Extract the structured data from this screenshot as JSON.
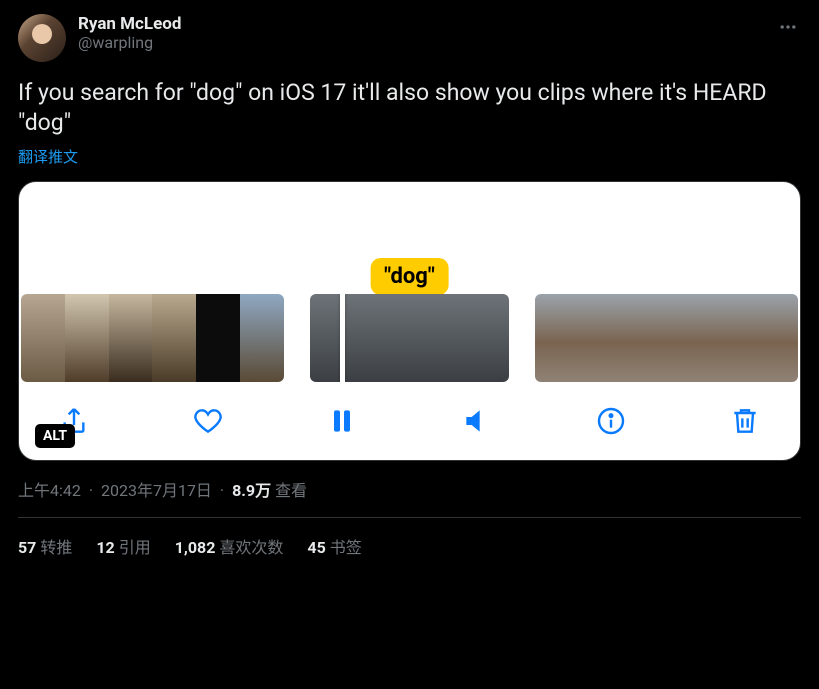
{
  "author": {
    "display_name": "Ryan McLeod",
    "handle": "@warpling"
  },
  "tweet_text": "If you search for \"dog\" on iOS 17 it'll also show you clips where it's HEARD \"dog\"",
  "translate_label": "翻译推文",
  "media": {
    "tooltip_text": "\"dog\"",
    "alt_badge": "ALT"
  },
  "meta": {
    "time": "上午4:42",
    "date": "2023年7月17日",
    "views_count": "8.9万",
    "views_label": "查看"
  },
  "engagement": {
    "retweets": {
      "count": "57",
      "label": "转推"
    },
    "quotes": {
      "count": "12",
      "label": "引用"
    },
    "likes": {
      "count": "1,082",
      "label": "喜欢次数"
    },
    "bookmarks": {
      "count": "45",
      "label": "书签"
    }
  }
}
